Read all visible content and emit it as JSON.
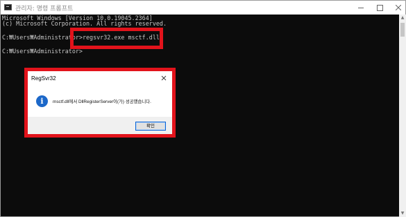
{
  "window": {
    "title": "관리자: 명령 프롬프트",
    "icon": "cmd-icon",
    "controls": {
      "minimize": "minimize-icon",
      "maximize": "maximize-icon",
      "close": "close-icon"
    }
  },
  "console": {
    "lines": [
      "Microsoft Windows [Version 10.0.19045.2364]",
      "(c) Microsoft Corporation. All rights reserved.",
      "C:₩Users₩Administrator>regsvr32.exe msctf.dll",
      "C:₩Users₩Administrator>"
    ],
    "background": "#0c0c0c",
    "foreground": "#c8c8c8"
  },
  "dialog": {
    "title": "RegSvr32",
    "icon": "info-icon",
    "message": "msctf.dll에서 DllRegisterServer이(가) 성공했습니다.",
    "ok_label": "확인"
  },
  "annotations": {
    "highlight_color": "#e2131b"
  }
}
